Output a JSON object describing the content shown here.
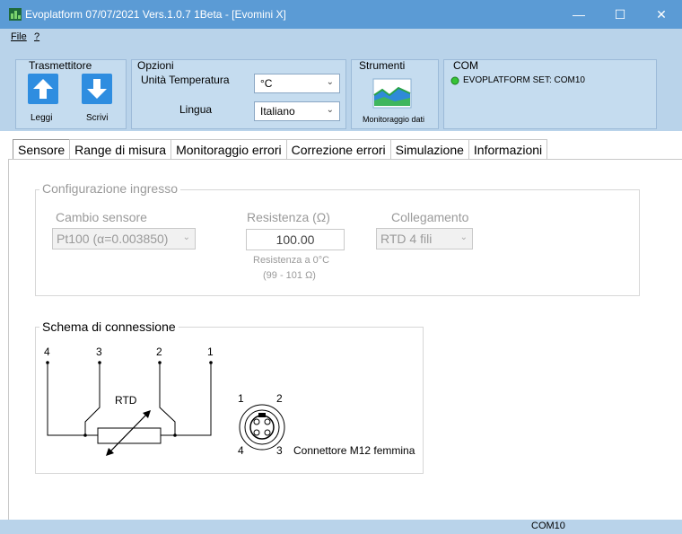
{
  "window": {
    "title": "Evoplatform 07/07/2021 Vers.1.0.7 1Beta - [Evomini X]",
    "minimize_glyph": "—",
    "maximize_glyph": "☐",
    "close_glyph": "✕"
  },
  "menu": {
    "file": "File",
    "help": "?"
  },
  "ribbon": {
    "trasmettitore": {
      "title": "Trasmettitore",
      "read_label": "Leggi",
      "write_label": "Scrivi"
    },
    "opzioni": {
      "title": "Opzioni",
      "unit_label": "Unità Temperatura",
      "unit_value": "°C",
      "language_label": "Lingua",
      "language_value": "Italiano"
    },
    "strumenti": {
      "title": "Strumenti",
      "monitor_label": "Monitoraggio dati"
    },
    "com": {
      "title": "COM",
      "status_text": "EVOPLATFORM SET: COM10",
      "status_color": "#36c336"
    }
  },
  "tabs": [
    "Sensore",
    "Range di misura",
    "Monitoraggio errori",
    "Correzione errori",
    "Simulazione",
    "Informazioni"
  ],
  "config": {
    "legend": "Configurazione ingresso",
    "sensor_label": "Cambio sensore",
    "sensor_value": "Pt100 (α=0.003850)",
    "resistance_label": "Resistenza (Ω)",
    "resistance_value": "100.00",
    "resistance_note_1": "Resistenza a 0°C",
    "resistance_note_2": "(99 - 101 Ω)",
    "connection_label": "Collegamento",
    "connection_value": "RTD 4 fili"
  },
  "schema": {
    "legend": "Schema di connessione",
    "pins": [
      "4",
      "3",
      "2",
      "1"
    ],
    "rtd_label": "RTD",
    "m12_pins": [
      "1",
      "2",
      "4",
      "3"
    ],
    "connector_label": "Connettore M12 femmina"
  },
  "status": {
    "port": "COM10"
  },
  "colors": {
    "title_bar": "#5b9bd5",
    "ribbon": "#b9d3ea",
    "button_blue": "#2e8de0"
  }
}
